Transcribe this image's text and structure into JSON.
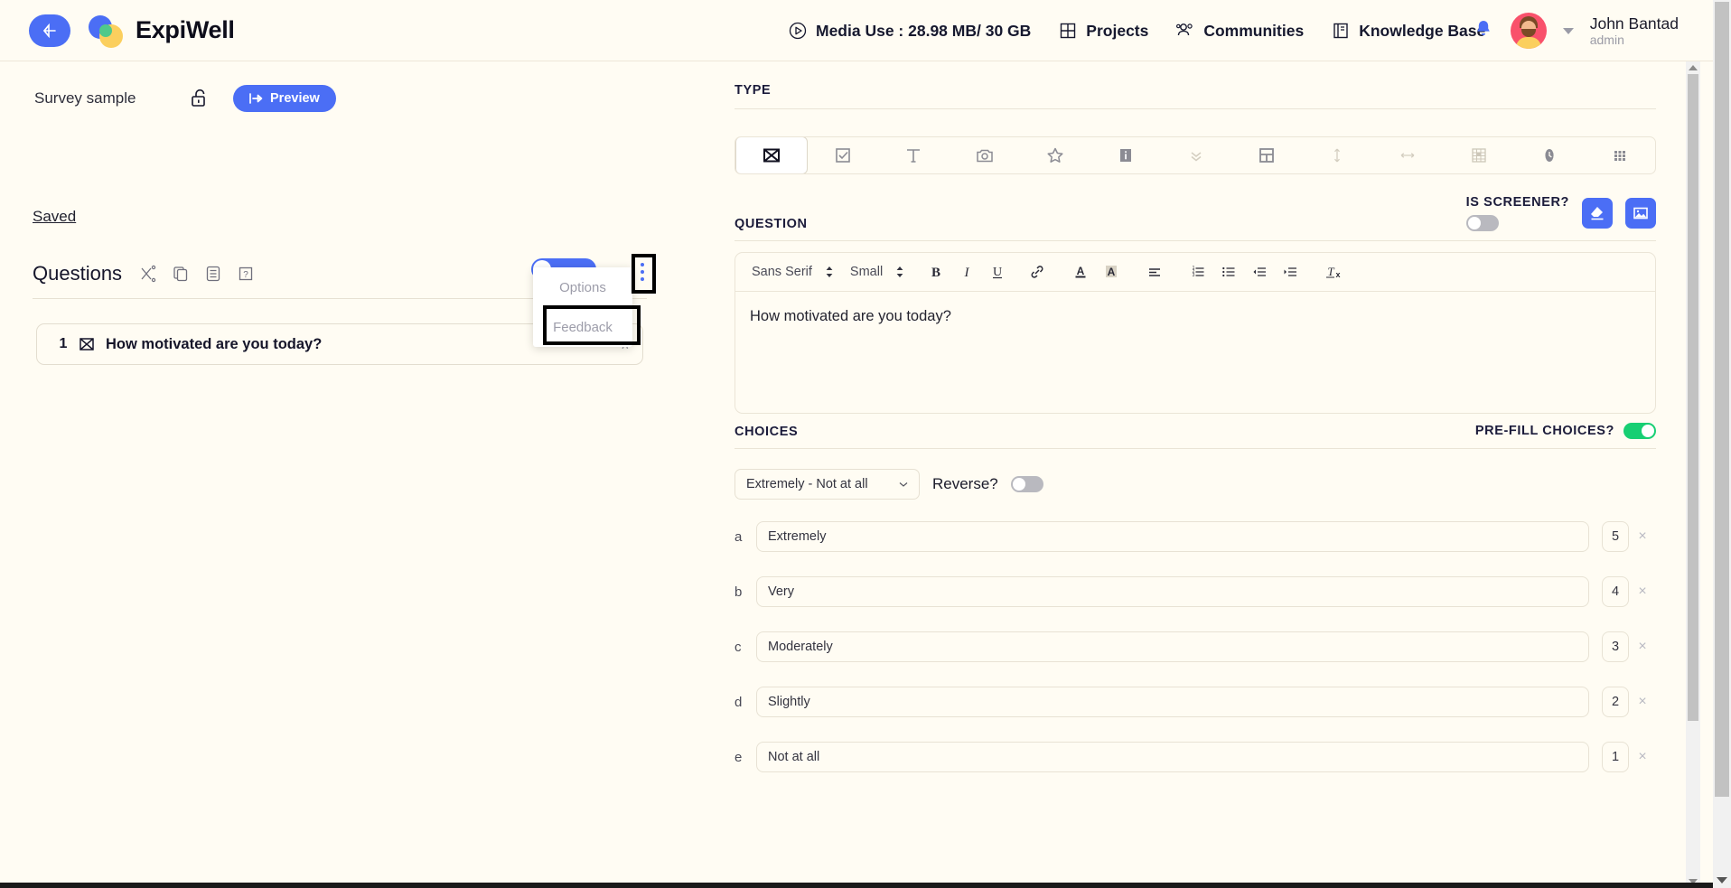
{
  "brand": {
    "name": "ExpiWell",
    "accent": "#4b6ef5",
    "background": "#fffcf3"
  },
  "topbar": {
    "back_label": "back-arrow",
    "nav": [
      {
        "label": "Media Use : 28.98 MB/ 30 GB",
        "icon": "play-circle-icon"
      },
      {
        "label": "Projects",
        "icon": "grid-icon"
      },
      {
        "label": "Communities",
        "icon": "people-icon"
      },
      {
        "label": "Knowledge Base",
        "icon": "book-icon"
      }
    ],
    "notifications_icon": "bell-icon",
    "user": {
      "name": "John Bantad",
      "role": "admin"
    }
  },
  "left": {
    "survey_title": "Survey sample",
    "lock_icon": "unlock-icon",
    "preview_label": "Preview",
    "saved_label": "Saved",
    "questions_label": "Questions",
    "question_tools": [
      "shuffle-icon",
      "copy-icon",
      "list-icon",
      "help-icon"
    ],
    "menu": {
      "options_label": "Options",
      "feedback_label": "Feedback"
    },
    "question_row": {
      "number": "1",
      "type_icon": "slider-scale-icon",
      "text": "How motivated are you today?",
      "chevron": "∧"
    }
  },
  "right": {
    "type": {
      "label": "TYPE",
      "icons": [
        "scale-icon",
        "checkbox-icon",
        "text-icon",
        "camera-icon",
        "star-icon",
        "info-icon",
        "chevrons-down-icon",
        "layout-icon",
        "vertical-arrows-icon",
        "horizontal-arrows-icon",
        "spreadsheet-icon",
        "clock-icon",
        "dots-grid-icon"
      ],
      "active_index": 0
    },
    "question": {
      "label": "QUESTION",
      "is_screener_label": "IS SCREENER?",
      "is_screener_on": false,
      "erase_icon": "eraser-icon",
      "image_icon": "image-icon",
      "toolbar": {
        "font_family": "Sans Serif",
        "font_size": "Small",
        "buttons": [
          "bold",
          "italic",
          "underline",
          "link",
          "font-color",
          "highlight-color",
          "align",
          "ordered-list",
          "bullet-list",
          "outdent",
          "indent",
          "clear-format"
        ]
      },
      "body_text": "How motivated are you today?"
    },
    "choices": {
      "label": "CHOICES",
      "prefill_label": "PRE-FILL CHOICES?",
      "prefill_on": true,
      "scale_select": "Extremely - Not at all",
      "reverse_label": "Reverse?",
      "reverse_on": false,
      "rows": [
        {
          "letter": "a",
          "text": "Extremely",
          "value": "5",
          "remove": "×"
        },
        {
          "letter": "b",
          "text": "Very",
          "value": "4",
          "remove": "×"
        },
        {
          "letter": "c",
          "text": "Moderately",
          "value": "3",
          "remove": "×"
        },
        {
          "letter": "d",
          "text": "Slightly",
          "value": "2",
          "remove": "×"
        },
        {
          "letter": "e",
          "text": "Not at all",
          "value": "1",
          "remove": "×"
        }
      ]
    }
  }
}
